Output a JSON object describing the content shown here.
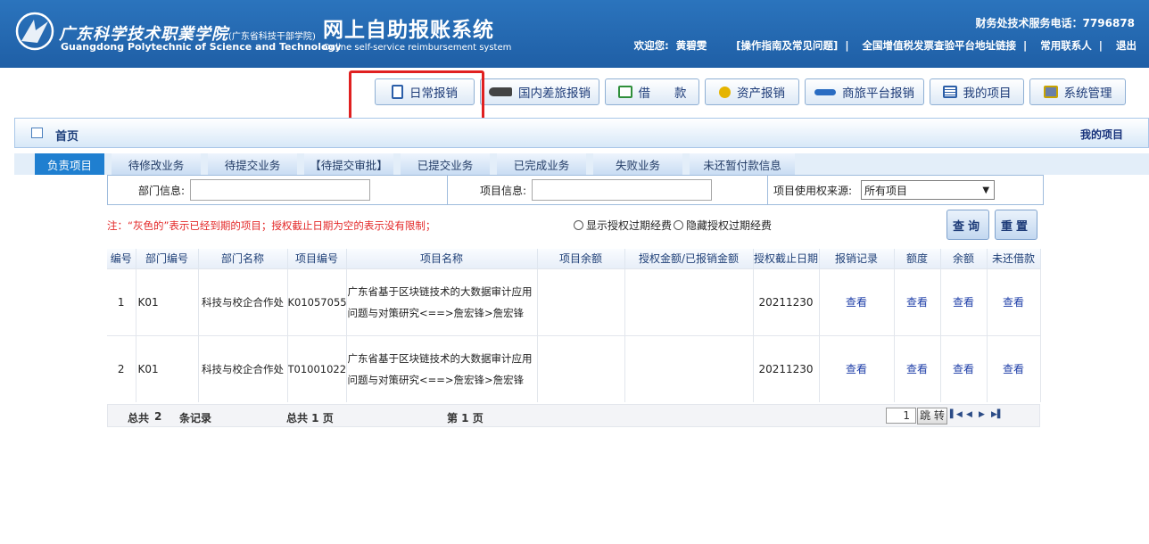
{
  "header": {
    "school_cn": "广东科学技术职業学院",
    "school_cn_sub": "(广东省科技干部学院)",
    "school_en": "Guangdong Polytechnic of Science and Technology",
    "system_title": "网上自助报账系统",
    "system_title_en": "Online self-service reimbursement system",
    "hotline": "财务处技术服务电话：7796878",
    "welcome": "欢迎您:",
    "user_name": "黄碧雯",
    "guide_link": "[操作指南及常见问题]",
    "invoice_link": "全国增值税发票查验平台地址链接",
    "contacts_link": "常用联系人",
    "logout_link": "退出",
    "separator": "|"
  },
  "toolbar": {
    "buttons": [
      {
        "label": "日常报销",
        "icon": "notebook-icon"
      },
      {
        "label": "国内差旅报销",
        "icon": "train-icon"
      },
      {
        "label": "借　　款",
        "icon": "loan-form-icon"
      },
      {
        "label": "资产报销",
        "icon": "coins-icon"
      },
      {
        "label": "商旅平台报销",
        "icon": "plane-icon"
      },
      {
        "label": "我的项目",
        "icon": "list-icon"
      },
      {
        "label": "系统管理",
        "icon": "computer-icon"
      }
    ]
  },
  "home_bar": {
    "title": "首页",
    "right": "我的项目"
  },
  "tabs": [
    "负责项目",
    "待修改业务",
    "待提交业务",
    "【待提交审批】",
    "已提交业务",
    "已完成业务",
    "失败业务",
    "未还暂付款信息"
  ],
  "active_tab": "负责项目",
  "filter": {
    "dept_label": "部门信息:",
    "dept_value": "",
    "project_label": "项目信息:",
    "project_value": "",
    "source_label": "项目使用权来源:",
    "source_selected": "所有项目"
  },
  "note": "注：“灰色的”表示已经到期的项目；授权截止日期为空的表示没有限制；",
  "radios": {
    "show_expired": "显示授权过期经费",
    "hide_expired": "隐藏授权过期经费"
  },
  "buttons": {
    "query": "查询",
    "reset": "重置"
  },
  "table": {
    "columns": [
      "编号",
      "部门编号",
      "部门名称",
      "项目编号",
      "项目名称",
      "项目余额",
      "授权金额/已报销金额",
      "授权截止日期",
      "报销记录",
      "额度",
      "余额",
      "未还借款"
    ],
    "rows": [
      {
        "no": "1",
        "dept_code": "K01",
        "dept_name": "科技与校企合作处",
        "proj_code": "K01057055",
        "proj_name": "广东省基于区块链技术的大数据审计应用问题与对策研究<==>詹宏锋>詹宏锋",
        "balance": "",
        "auth": "",
        "deadline": "20211230",
        "record": "查看",
        "quota": "查看",
        "remain": "查看",
        "loan": "查看"
      },
      {
        "no": "2",
        "dept_code": "K01",
        "dept_name": "科技与校企合作处",
        "proj_code": "T01001022",
        "proj_name": "广东省基于区块链技术的大数据审计应用问题与对策研究<==>詹宏锋>詹宏锋",
        "balance": "",
        "auth": "",
        "deadline": "20211230",
        "record": "查看",
        "quota": "查看",
        "remain": "查看",
        "loan": "查看"
      }
    ]
  },
  "pager": {
    "total_label": "总共",
    "total_count": "2",
    "records_label": "条记录",
    "pages_text": "总共  1 页",
    "current_text": "第  1 页",
    "page_input": "1",
    "jump": "跳 转"
  }
}
